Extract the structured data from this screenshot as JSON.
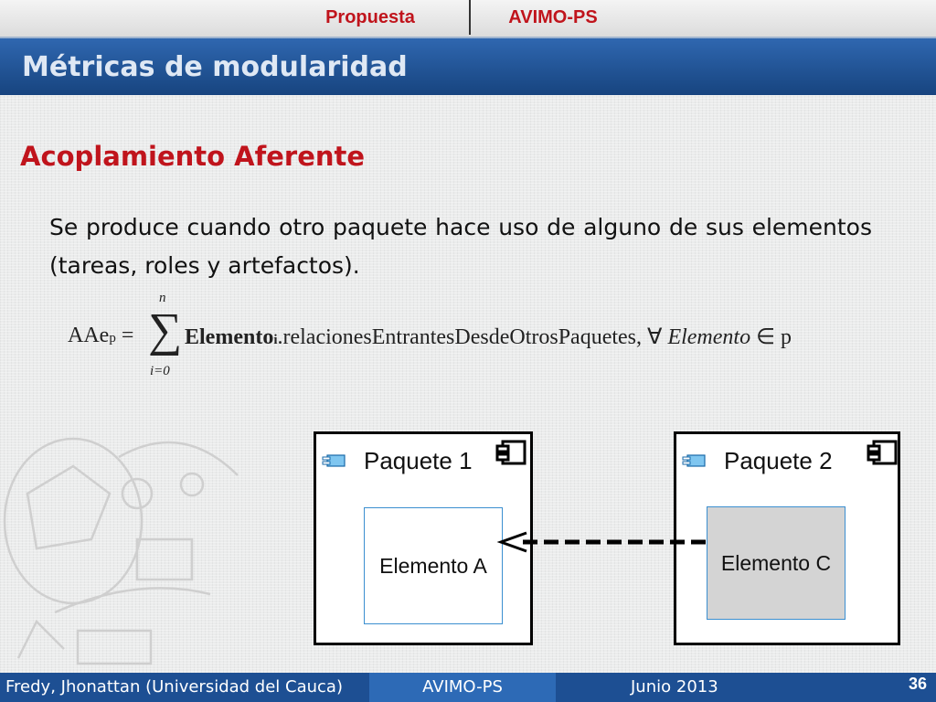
{
  "nav": {
    "tab1": "Propuesta",
    "tab2": "AVIMO-PS"
  },
  "slide": {
    "title": "Métricas de modularidad",
    "heading": "Acoplamiento Aferente",
    "body": "Se produce cuando otro paquete hace uso de alguno de sus elementos (tareas, roles y artefactos)."
  },
  "formula": {
    "lhs": "AAe",
    "lhs_sub": "p",
    "equals": "=",
    "sum_upper": "n",
    "sum_lower": "i=0",
    "term": "Elemento",
    "term_sub": "i",
    "rest": ".relacionesEntrantesDesdeOtrosPaquetes",
    "forall": ", ∀ ",
    "var": "Elemento",
    "in": " ∈ p"
  },
  "diagram": {
    "package1": {
      "title": "Paquete 1",
      "element": "Elemento A"
    },
    "package2": {
      "title": "Paquete 2",
      "element": "Elemento C"
    }
  },
  "footer": {
    "authors": "Fredy, Jhonattan (Universidad del Cauca)",
    "project": "AVIMO-PS",
    "date": "Junio 2013",
    "page": "36"
  },
  "colors": {
    "accent_red": "#c0141c",
    "title_blue": "#1d4f93",
    "element_gray": "#d4d4d4",
    "element_border": "#3b8fd0"
  },
  "icons": {
    "package": "package-icon",
    "component": "component-icon",
    "background": "sketch-decoration"
  }
}
